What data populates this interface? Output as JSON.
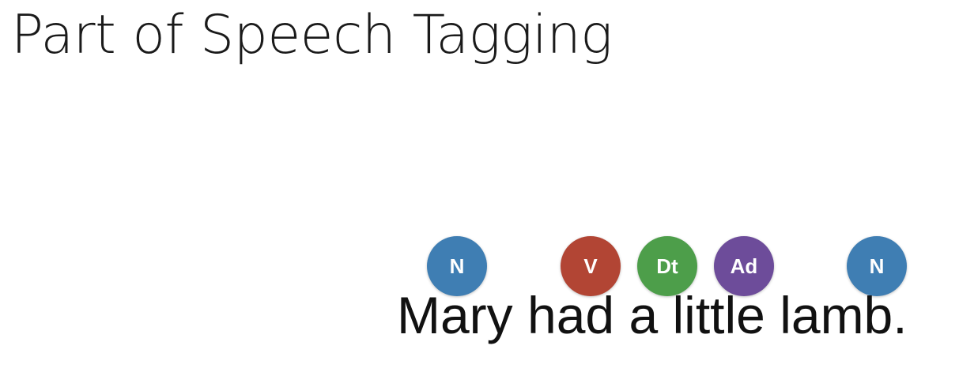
{
  "title": "Part of Speech Tagging",
  "sentence": "Mary had a little lamb.",
  "tags": [
    {
      "label": "N",
      "color": "#3f7eb3"
    },
    {
      "label": "V",
      "color": "#b24534"
    },
    {
      "label": "Dt",
      "color": "#4d9e4a"
    },
    {
      "label": "Ad",
      "color": "#6d4c9a"
    },
    {
      "label": "N",
      "color": "#3f7eb3"
    }
  ]
}
